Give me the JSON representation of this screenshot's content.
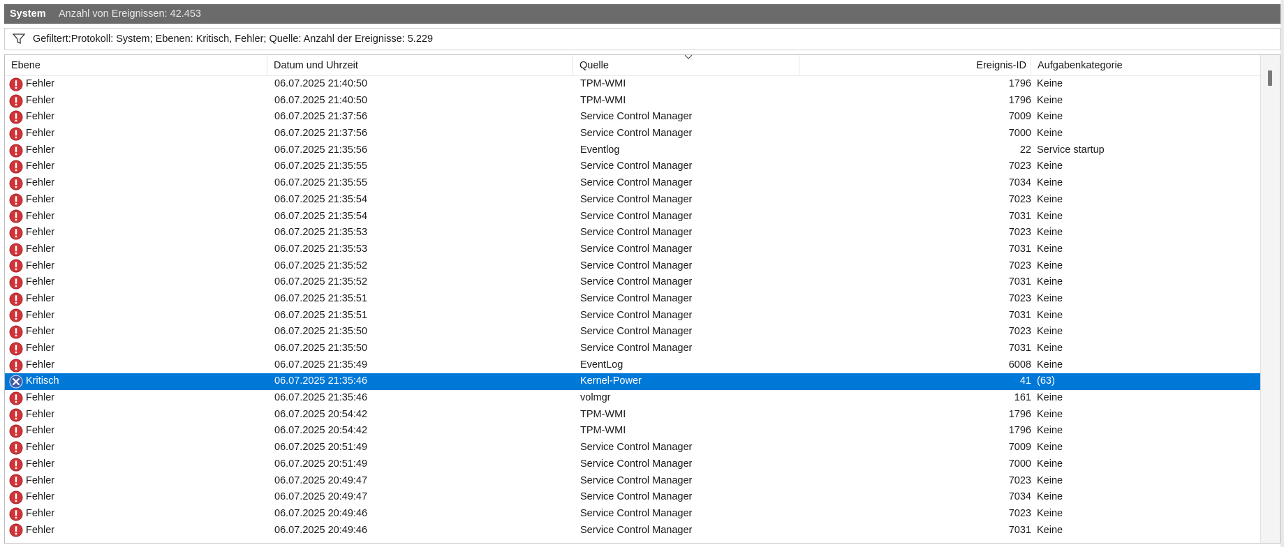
{
  "window": {
    "title": "System",
    "event_count": "Anzahl von Ereignissen: 42.453"
  },
  "filter": {
    "icon": "filter-icon",
    "text": "Gefiltert:Protokoll: System; Ebenen: Kritisch, Fehler; Quelle:  Anzahl der Ereignisse: 5.229"
  },
  "columns": {
    "level": "Ebene",
    "date": "Datum und Uhrzeit",
    "source": "Quelle",
    "event_id": "Ereignis-ID",
    "category": "Aufgabenkategorie"
  },
  "colors": {
    "selection": "#0078d7",
    "error_icon": "#d13438",
    "critical_icon": "#3b5aa8",
    "titlebar": "#6b6b6b"
  },
  "events": [
    {
      "level": "Fehler",
      "icon": "error-icon",
      "date": "06.07.2025 21:40:50",
      "source": "TPM-WMI",
      "id": "1796",
      "category": "Keine"
    },
    {
      "level": "Fehler",
      "icon": "error-icon",
      "date": "06.07.2025 21:40:50",
      "source": "TPM-WMI",
      "id": "1796",
      "category": "Keine"
    },
    {
      "level": "Fehler",
      "icon": "error-icon",
      "date": "06.07.2025 21:37:56",
      "source": "Service Control Manager",
      "id": "7009",
      "category": "Keine"
    },
    {
      "level": "Fehler",
      "icon": "error-icon",
      "date": "06.07.2025 21:37:56",
      "source": "Service Control Manager",
      "id": "7000",
      "category": "Keine"
    },
    {
      "level": "Fehler",
      "icon": "error-icon",
      "date": "06.07.2025 21:35:56",
      "source": "Eventlog",
      "id": "22",
      "category": "Service startup"
    },
    {
      "level": "Fehler",
      "icon": "error-icon",
      "date": "06.07.2025 21:35:55",
      "source": "Service Control Manager",
      "id": "7023",
      "category": "Keine"
    },
    {
      "level": "Fehler",
      "icon": "error-icon",
      "date": "06.07.2025 21:35:55",
      "source": "Service Control Manager",
      "id": "7034",
      "category": "Keine"
    },
    {
      "level": "Fehler",
      "icon": "error-icon",
      "date": "06.07.2025 21:35:54",
      "source": "Service Control Manager",
      "id": "7023",
      "category": "Keine"
    },
    {
      "level": "Fehler",
      "icon": "error-icon",
      "date": "06.07.2025 21:35:54",
      "source": "Service Control Manager",
      "id": "7031",
      "category": "Keine"
    },
    {
      "level": "Fehler",
      "icon": "error-icon",
      "date": "06.07.2025 21:35:53",
      "source": "Service Control Manager",
      "id": "7023",
      "category": "Keine"
    },
    {
      "level": "Fehler",
      "icon": "error-icon",
      "date": "06.07.2025 21:35:53",
      "source": "Service Control Manager",
      "id": "7031",
      "category": "Keine"
    },
    {
      "level": "Fehler",
      "icon": "error-icon",
      "date": "06.07.2025 21:35:52",
      "source": "Service Control Manager",
      "id": "7023",
      "category": "Keine"
    },
    {
      "level": "Fehler",
      "icon": "error-icon",
      "date": "06.07.2025 21:35:52",
      "source": "Service Control Manager",
      "id": "7031",
      "category": "Keine"
    },
    {
      "level": "Fehler",
      "icon": "error-icon",
      "date": "06.07.2025 21:35:51",
      "source": "Service Control Manager",
      "id": "7023",
      "category": "Keine"
    },
    {
      "level": "Fehler",
      "icon": "error-icon",
      "date": "06.07.2025 21:35:51",
      "source": "Service Control Manager",
      "id": "7031",
      "category": "Keine"
    },
    {
      "level": "Fehler",
      "icon": "error-icon",
      "date": "06.07.2025 21:35:50",
      "source": "Service Control Manager",
      "id": "7023",
      "category": "Keine"
    },
    {
      "level": "Fehler",
      "icon": "error-icon",
      "date": "06.07.2025 21:35:50",
      "source": "Service Control Manager",
      "id": "7031",
      "category": "Keine"
    },
    {
      "level": "Fehler",
      "icon": "error-icon",
      "date": "06.07.2025 21:35:49",
      "source": "EventLog",
      "id": "6008",
      "category": "Keine"
    },
    {
      "level": "Kritisch",
      "icon": "critical-icon",
      "date": "06.07.2025 21:35:46",
      "source": "Kernel-Power",
      "id": "41",
      "category": "(63)",
      "selected": true
    },
    {
      "level": "Fehler",
      "icon": "error-icon",
      "date": "06.07.2025 21:35:46",
      "source": "volmgr",
      "id": "161",
      "category": "Keine"
    },
    {
      "level": "Fehler",
      "icon": "error-icon",
      "date": "06.07.2025 20:54:42",
      "source": "TPM-WMI",
      "id": "1796",
      "category": "Keine"
    },
    {
      "level": "Fehler",
      "icon": "error-icon",
      "date": "06.07.2025 20:54:42",
      "source": "TPM-WMI",
      "id": "1796",
      "category": "Keine"
    },
    {
      "level": "Fehler",
      "icon": "error-icon",
      "date": "06.07.2025 20:51:49",
      "source": "Service Control Manager",
      "id": "7009",
      "category": "Keine"
    },
    {
      "level": "Fehler",
      "icon": "error-icon",
      "date": "06.07.2025 20:51:49",
      "source": "Service Control Manager",
      "id": "7000",
      "category": "Keine"
    },
    {
      "level": "Fehler",
      "icon": "error-icon",
      "date": "06.07.2025 20:49:47",
      "source": "Service Control Manager",
      "id": "7023",
      "category": "Keine"
    },
    {
      "level": "Fehler",
      "icon": "error-icon",
      "date": "06.07.2025 20:49:47",
      "source": "Service Control Manager",
      "id": "7034",
      "category": "Keine"
    },
    {
      "level": "Fehler",
      "icon": "error-icon",
      "date": "06.07.2025 20:49:46",
      "source": "Service Control Manager",
      "id": "7023",
      "category": "Keine"
    },
    {
      "level": "Fehler",
      "icon": "error-icon",
      "date": "06.07.2025 20:49:46",
      "source": "Service Control Manager",
      "id": "7031",
      "category": "Keine"
    }
  ]
}
